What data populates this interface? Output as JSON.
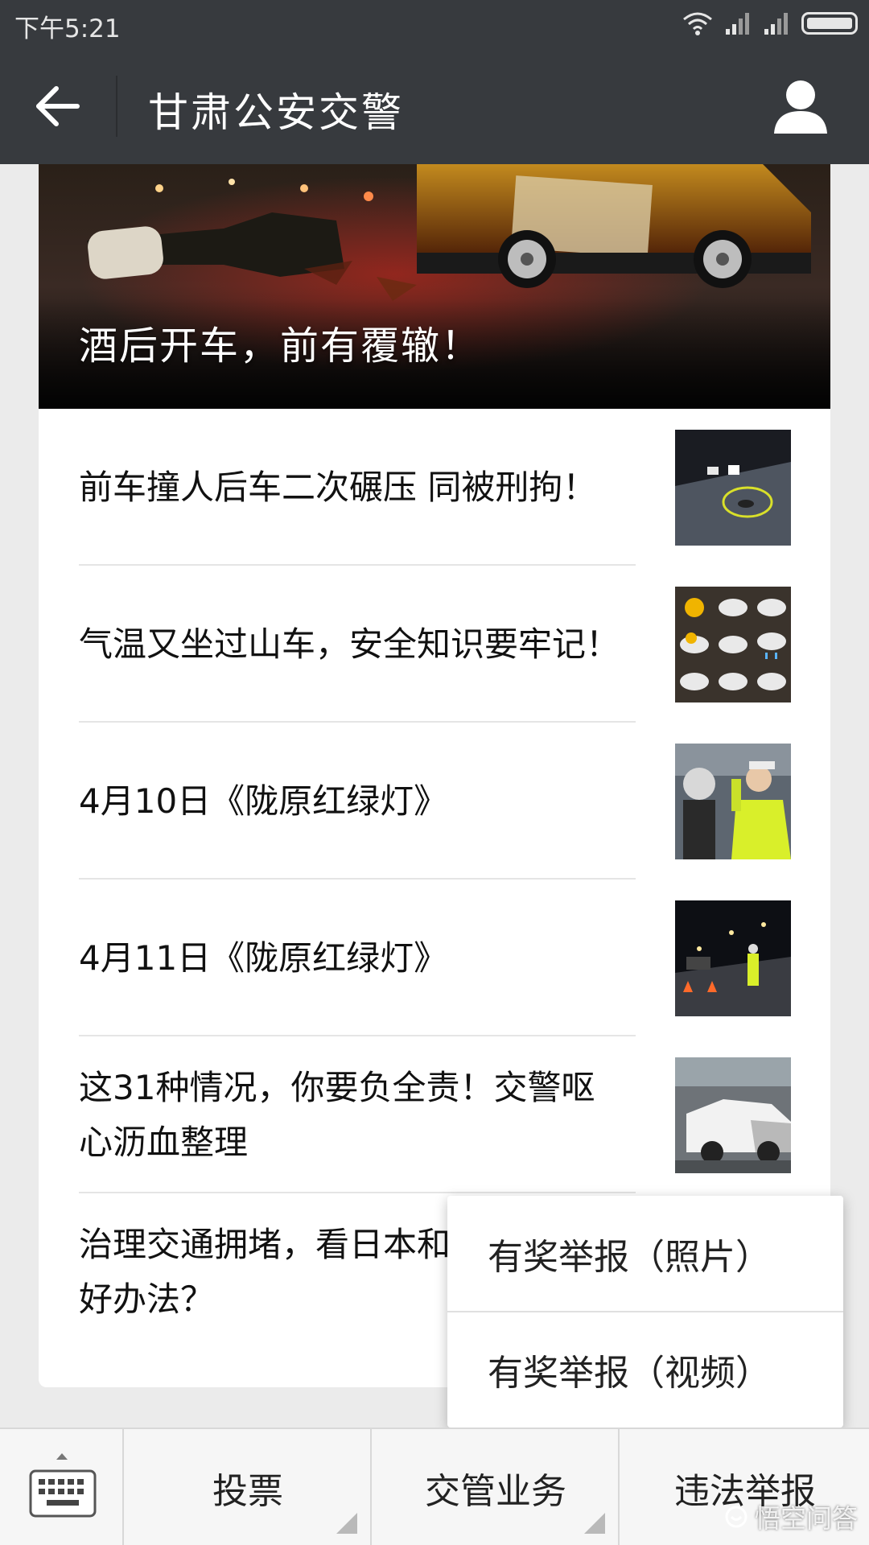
{
  "status_bar": {
    "time": "下午5:21",
    "icons": [
      "wifi-icon",
      "signal-icon",
      "signal-icon",
      "battery-icon"
    ]
  },
  "header": {
    "title": "甘肃公安交警",
    "back_icon": "arrow-left-icon",
    "profile_icon": "person-icon"
  },
  "hero": {
    "title": "酒后开车，前有覆辙！"
  },
  "articles": [
    {
      "title": "前车撞人后车二次碾压 同被刑拘！",
      "thumb": "night-accident-scene"
    },
    {
      "title": "气温又坐过山车，安全知识要牢记！",
      "thumb": "weather-icons-grid"
    },
    {
      "title": "4月10日《陇原红绿灯》",
      "thumb": "traffic-police-checking"
    },
    {
      "title": "4月11日《陇原红绿灯》",
      "thumb": "night-traffic-checkpoint"
    },
    {
      "title": "这31种情况，你要负全责！交警呕心沥血整理",
      "thumb": "crashed-white-car"
    },
    {
      "title": "治理交通拥堵，看日本和……有什么好办法？",
      "thumb": ""
    }
  ],
  "popup_menu": {
    "items": [
      "有奖举报（照片）",
      "有奖举报（视频）"
    ]
  },
  "bottom_bar": {
    "keyboard_icon": "keyboard-icon",
    "menus": [
      "投票",
      "交管业务",
      "违法举报"
    ]
  },
  "watermark": {
    "text": "悟空问答"
  },
  "colors": {
    "header_bg": "#373a3e",
    "page_bg": "#ebebeb",
    "card_bg": "#ffffff"
  }
}
